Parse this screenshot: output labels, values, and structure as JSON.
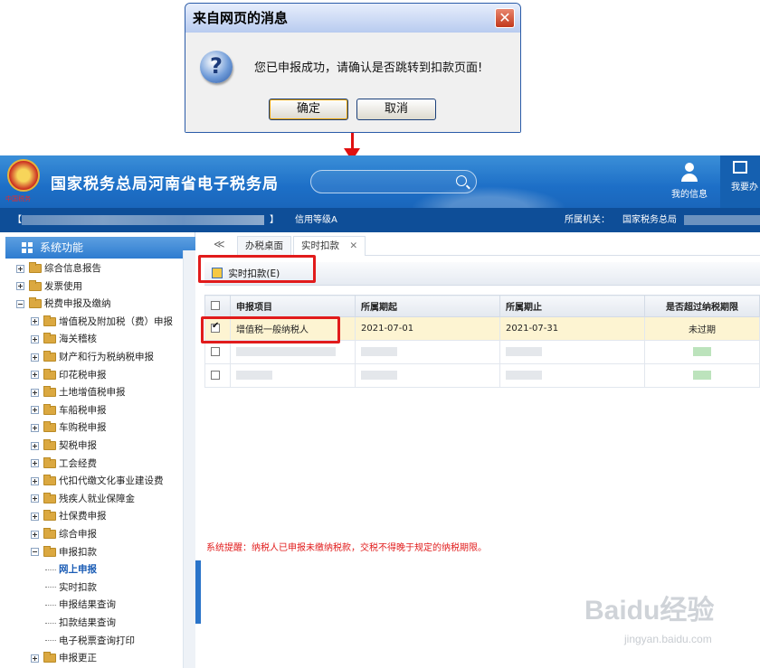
{
  "dialog": {
    "title": "来自网页的消息",
    "close_glyph": "✕",
    "icon_glyph": "?",
    "message": "您已申报成功，请确认是否跳转到扣款页面!",
    "ok_label": "确定",
    "cancel_label": "取消"
  },
  "header": {
    "emblem_caption": "中国税务",
    "title": "国家税务总局河南省电子税务局",
    "search_placeholder": "",
    "user_label": "我的信息",
    "action_label": "我要办"
  },
  "info_bar": {
    "bracket_open": "【",
    "bracket_close": "】",
    "credit_level": "信用等级A",
    "agency_label": "所属机关：",
    "agency_value": "国家税务总局"
  },
  "sidebar": {
    "title": "系统功能",
    "items": [
      {
        "label": "综合信息报告",
        "level": 0,
        "kind": "plus"
      },
      {
        "label": "发票使用",
        "level": 0,
        "kind": "plus"
      },
      {
        "label": "税费申报及缴纳",
        "level": 0,
        "kind": "minus"
      },
      {
        "label": "增值税及附加税（费）申报",
        "level": 1,
        "kind": "plus"
      },
      {
        "label": "海关稽核",
        "level": 1,
        "kind": "plus"
      },
      {
        "label": "财产和行为税纳税申报",
        "level": 1,
        "kind": "plus"
      },
      {
        "label": "印花税申报",
        "level": 1,
        "kind": "plus"
      },
      {
        "label": "土地增值税申报",
        "level": 1,
        "kind": "plus"
      },
      {
        "label": "车船税申报",
        "level": 1,
        "kind": "plus"
      },
      {
        "label": "车购税申报",
        "level": 1,
        "kind": "plus"
      },
      {
        "label": "契税申报",
        "level": 1,
        "kind": "plus"
      },
      {
        "label": "工会经费",
        "level": 1,
        "kind": "plus"
      },
      {
        "label": "代扣代缴文化事业建设费",
        "level": 1,
        "kind": "plus"
      },
      {
        "label": "残疾人就业保障金",
        "level": 1,
        "kind": "plus"
      },
      {
        "label": "社保费申报",
        "level": 1,
        "kind": "plus"
      },
      {
        "label": "综合申报",
        "level": 1,
        "kind": "plus"
      },
      {
        "label": "申报扣款",
        "level": 1,
        "kind": "minus"
      },
      {
        "label": "网上申报",
        "level": 2,
        "kind": "leaf",
        "selected": true
      },
      {
        "label": "实时扣款",
        "level": 2,
        "kind": "leaf"
      },
      {
        "label": "申报结果查询",
        "level": 2,
        "kind": "leaf"
      },
      {
        "label": "扣款结果查询",
        "level": 2,
        "kind": "leaf"
      },
      {
        "label": "电子税票查询打印",
        "level": 2,
        "kind": "leaf"
      },
      {
        "label": "申报更正",
        "level": 1,
        "kind": "plus"
      }
    ]
  },
  "tabs": {
    "back_glyph": "≪",
    "items": [
      {
        "label": "办税桌面"
      },
      {
        "label": "实时扣款",
        "close_glyph": "✕"
      }
    ]
  },
  "toolbar": {
    "button_label": "实时扣款(E)"
  },
  "table": {
    "headers": [
      "申报项目",
      "所属期起",
      "所属期止",
      "是否超过纳税期限"
    ],
    "rows": [
      {
        "checked": true,
        "item": "增值税一般纳税人",
        "start": "2021-07-01",
        "end": "2021-07-31",
        "status": "未过期"
      }
    ]
  },
  "tip": "系统提醒：纳税人已申报未缴纳税款，交税不得晚于规定的纳税期限。",
  "watermark": {
    "main": "Baidu经验",
    "sub": "jingyan.baidu.com"
  },
  "colors": {
    "accent": "#1d6fc7",
    "highlight_border": "#e11b1b",
    "status_ok": "#1f9a1f"
  }
}
